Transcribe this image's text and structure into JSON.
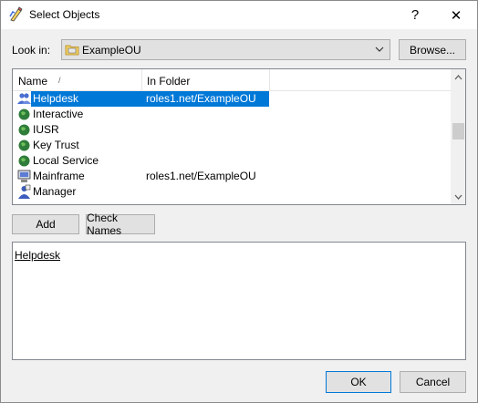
{
  "window": {
    "title": "Select Objects",
    "help_label": "?",
    "close_label": "✕"
  },
  "look_in": {
    "label": "Look in:",
    "value": "ExampleOU",
    "browse_label": "Browse..."
  },
  "list": {
    "columns": [
      "Name",
      "In Folder"
    ],
    "sort_indicator": "/",
    "rows": [
      {
        "name": "Helpdesk",
        "folder": "roles1.net/ExampleOU",
        "icon": "group-icon",
        "selected": true
      },
      {
        "name": "Interactive",
        "folder": "",
        "icon": "globe-icon",
        "selected": false
      },
      {
        "name": "IUSR",
        "folder": "",
        "icon": "globe-icon",
        "selected": false
      },
      {
        "name": "Key Trust",
        "folder": "",
        "icon": "globe-icon",
        "selected": false
      },
      {
        "name": "Local Service",
        "folder": "",
        "icon": "globe-icon",
        "selected": false
      },
      {
        "name": "Mainframe",
        "folder": "roles1.net/ExampleOU",
        "icon": "computer-icon",
        "selected": false
      },
      {
        "name": "Manager",
        "folder": "",
        "icon": "user-icon",
        "selected": false
      }
    ]
  },
  "buttons": {
    "add": "Add",
    "check_names": "Check Names",
    "ok": "OK",
    "cancel": "Cancel"
  },
  "selected_objects": {
    "text": "Helpdesk"
  }
}
